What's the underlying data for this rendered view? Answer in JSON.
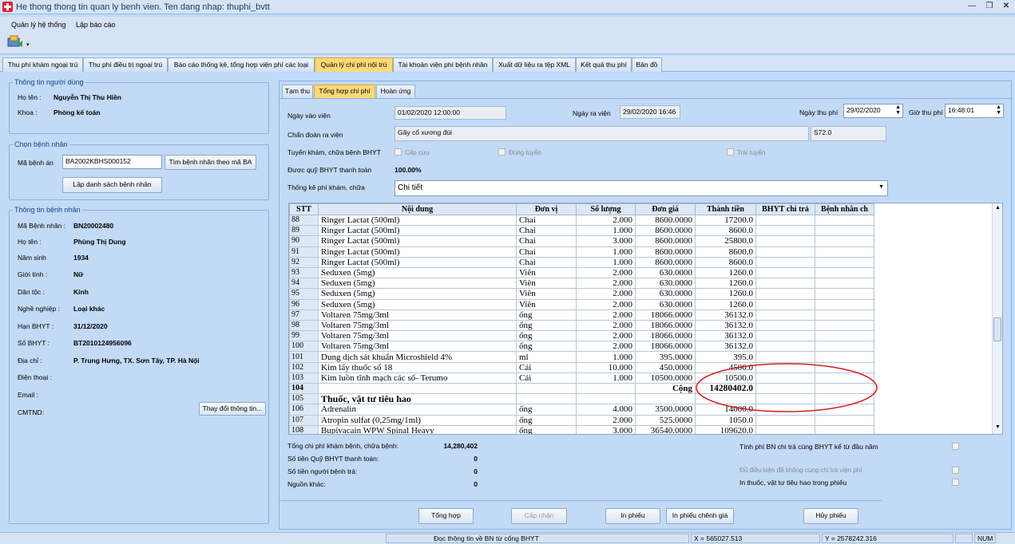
{
  "window": {
    "title": "He thong thong tin quan ly benh vien. Ten dang nhap: thuphi_bvtt"
  },
  "menu": {
    "items": [
      "Quản lý hệ thống",
      "Lập báo cáo"
    ]
  },
  "main_tabs": [
    {
      "label": "Thu phí khám ngoại trú"
    },
    {
      "label": "Thu phí điều trị ngoại trú"
    },
    {
      "label": "Báo cáo thống kê, tổng hợp viện phí các loại"
    },
    {
      "label": "Quản lý chi phí nội trú"
    },
    {
      "label": "Tài khoản viện phí bệnh nhân"
    },
    {
      "label": "Xuất dữ liệu ra tệp XML"
    },
    {
      "label": "Kết quả thu phí"
    },
    {
      "label": "Bản đồ"
    }
  ],
  "user_info": {
    "title": "Thông tin người dùng",
    "name_label": "Họ tên :",
    "name": "Nguyễn Thị Thu Hiền",
    "dept_label": "Khoa :",
    "dept": "Phòng kế toán"
  },
  "select_patient": {
    "title": "Chọn bệnh nhân",
    "record_label": "Mã bệnh án",
    "record_value": "BA2002KBHS000152",
    "search_button": "Tìm bệnh nhân theo mã BA",
    "list_button": "Lập danh sách bệnh nhân"
  },
  "patient_info": {
    "title": "Thông tin bệnh nhân",
    "fields": [
      {
        "label": "Mã Bệnh nhân :",
        "value": "BN20002480"
      },
      {
        "label": "Họ tên :",
        "value": "Phùng Thị Dung"
      },
      {
        "label": "Năm sinh",
        "value": "1934"
      },
      {
        "label": "Giới tính :",
        "value": "Nữ"
      },
      {
        "label": "Dân tộc :",
        "value": "Kinh"
      },
      {
        "label": "Nghề nghiệp :",
        "value": "Loại khác"
      },
      {
        "label": "Hạn BHYT :",
        "value": "31/12/2020"
      },
      {
        "label": "Số BHYT :",
        "value": "BT2010124956096"
      },
      {
        "label": "Địa chỉ :",
        "value": "P. Trung Hưng, TX. Sơn Tây, TP. Hà Nội"
      },
      {
        "label": "Điện thoại :",
        "value": ""
      },
      {
        "label": "Email :",
        "value": ""
      },
      {
        "label": "CMTND:",
        "value": ""
      }
    ],
    "change_button": "Thay đổi thông tin..."
  },
  "sub_tabs": [
    "Tạm thu",
    "Tổng hợp chi phí",
    "Hoàn ứng"
  ],
  "details": {
    "admit_label": "Ngày vào viện",
    "admit_value": "01/02/2020 12:00:00",
    "discharge_label": "Ngày ra viện",
    "discharge_value": "29/02/2020 16:46",
    "pay_date_label": "Ngày thu phí",
    "pay_date_value": "29/02/2020",
    "pay_time_label": "Giờ thu phí",
    "pay_time_value": "16:48:01",
    "diagnosis_label": "Chẩn đoán ra viện",
    "diagnosis_value": "Gãy cổ xương đùi",
    "icd_value": "S72.0",
    "route_label": "Tuyến khám, chữa bệnh BHYT",
    "emergency_label": "Cấp cứu",
    "correct_route_label": "Đúng tuyến",
    "wrong_route_label": "Trái tuyến",
    "coverage_label": "Được quỹ BHYT thanh toán",
    "coverage_value": "100.00%",
    "stat_label": "Thống kê phí khám, chữa",
    "stat_value": "Chi tiết"
  },
  "grid": {
    "columns": [
      "STT",
      "Nội dung",
      "Đơn vị",
      "Số lượng",
      "Đơn giá",
      "Thành tiền",
      "BHYT chi trả",
      "Bệnh nhân ch"
    ],
    "rows": [
      [
        "88",
        "Ringer Lactat (500ml)",
        "Chai",
        "2.000",
        "8600.0000",
        "17200.0"
      ],
      [
        "89",
        "Ringer Lactat (500ml)",
        "Chai",
        "1.000",
        "8600.0000",
        "8600.0"
      ],
      [
        "90",
        "Ringer Lactat (500ml)",
        "Chai",
        "3.000",
        "8600.0000",
        "25800.0"
      ],
      [
        "91",
        "Ringer Lactat (500ml)",
        "Chai",
        "1.000",
        "8600.0000",
        "8600.0"
      ],
      [
        "92",
        "Ringer Lactat (500ml)",
        "Chai",
        "1.000",
        "8600.0000",
        "8600.0"
      ],
      [
        "93",
        "Seduxen (5mg)",
        "Viên",
        "2.000",
        "630.0000",
        "1260.0"
      ],
      [
        "94",
        "Seduxen (5mg)",
        "Viên",
        "2.000",
        "630.0000",
        "1260.0"
      ],
      [
        "95",
        "Seduxen (5mg)",
        "Viên",
        "2.000",
        "630.0000",
        "1260.0"
      ],
      [
        "96",
        "Seduxen (5mg)",
        "Viên",
        "2.000",
        "630.0000",
        "1260.0"
      ],
      [
        "97",
        "Voltaren 75mg/3ml",
        "ống",
        "2.000",
        "18066.0000",
        "36132.0"
      ],
      [
        "98",
        "Voltaren 75mg/3ml",
        "ống",
        "2.000",
        "18066.0000",
        "36132.0"
      ],
      [
        "99",
        "Voltaren 75mg/3ml",
        "ống",
        "2.000",
        "18066.0000",
        "36132.0"
      ],
      [
        "100",
        "Voltaren 75mg/3ml",
        "ống",
        "2.000",
        "18066.0000",
        "36132.0"
      ],
      [
        "101",
        "Dung dịch sát khuẩn Microshield 4%",
        "ml",
        "1.000",
        "395.0000",
        "395.0"
      ],
      [
        "102",
        "Kim lấy thuốc số 18",
        "Cái",
        "10.000",
        "450.0000",
        "4500.0"
      ],
      [
        "103",
        "Kim luồn tĩnh mạch các số- Terumo",
        "Cái",
        "1.000",
        "10500.0000",
        "10500.0"
      ]
    ],
    "sum_row": {
      "stt": "104",
      "label": "Cộng",
      "value": "14280402.0"
    },
    "section_row": {
      "stt": "105",
      "label": "Thuốc, vật tư tiêu hao"
    },
    "rows2": [
      [
        "106",
        "Adrenalin",
        "ống",
        "4.000",
        "3500.0000",
        "14000.0"
      ],
      [
        "107",
        "Atropin sulfat (0,25mg/1ml)",
        "ống",
        "2.000",
        "525.0000",
        "1050.0"
      ],
      [
        "108",
        "Bupivacain WPW Spinal  Heavy",
        "ống",
        "3.000",
        "36540.0000",
        "109620.0"
      ]
    ]
  },
  "summary": {
    "total_label": "Tổng chi phí khám bệnh, chữa bệnh:",
    "total_value": "14,280,402",
    "fund_label": "Số tiền Quỹ BHYT thanh toán:",
    "fund_value": "0",
    "patient_label": "Số tiền người bệnh trả:",
    "patient_value": "0",
    "other_label": "Nguồn khác:",
    "other_value": "0",
    "opt1": "Tính phí BN chi trả cùng BHYT kể từ đầu năm",
    "opt2": "Đủ điều kiện để không cùng chi trả viện phí",
    "opt3": "In thuốc, vật tư tiêu hao trong phiếu"
  },
  "buttons": {
    "summarize": "Tổng hợp",
    "advance": "Cấp nhận",
    "print": "In phiếu",
    "print_diff": "In phiếu chênh giá",
    "cancel": "Hủy phiếu"
  },
  "status": {
    "message": "Đọc thông tin về BN từ cổng BHYT",
    "x": "X = 565027.513",
    "y": "Y = 2578242.316",
    "num": "NUM"
  },
  "colors": {
    "annotation": "#d21c1c",
    "active_tab": "#ffd878"
  }
}
